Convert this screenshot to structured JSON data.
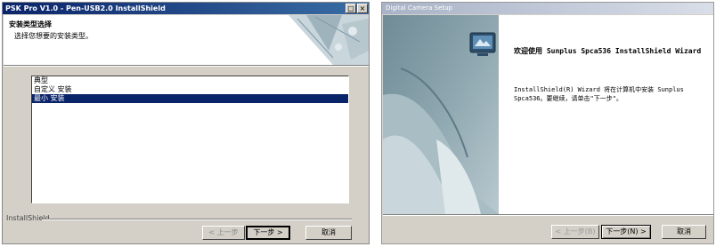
{
  "left_dialog": {
    "title": "PSK Pro V1.0 - Pen-USB2.0 InstallShield",
    "header_title": "安装类型选择",
    "header_subtitle": "选择您想要的安装类型。",
    "list_items": [
      "典型",
      "自定义 安装",
      "最小 安装"
    ],
    "selected_index": 2,
    "brand": "InstallShield",
    "buttons": {
      "back": "< 上一步",
      "next": "下一步 >",
      "cancel": "取消"
    }
  },
  "right_dialog": {
    "title": "Digital Camera Setup",
    "heading": "欢迎使用 Sunplus Spca536 InstallShield Wizard",
    "body": "InstallShield(R) Wizard 将在计算机中安装 Sunplus Spca536。要继续，请单击\"下一步\"。",
    "buttons": {
      "back": "< 上一步(B)",
      "next": "下一步(N) >",
      "cancel": "取消"
    }
  },
  "colors": {
    "title_active": "#0a246a",
    "title_inactive": "#a8b3c7",
    "dialog_face": "#d4d0c8",
    "selection": "#0a246a"
  }
}
